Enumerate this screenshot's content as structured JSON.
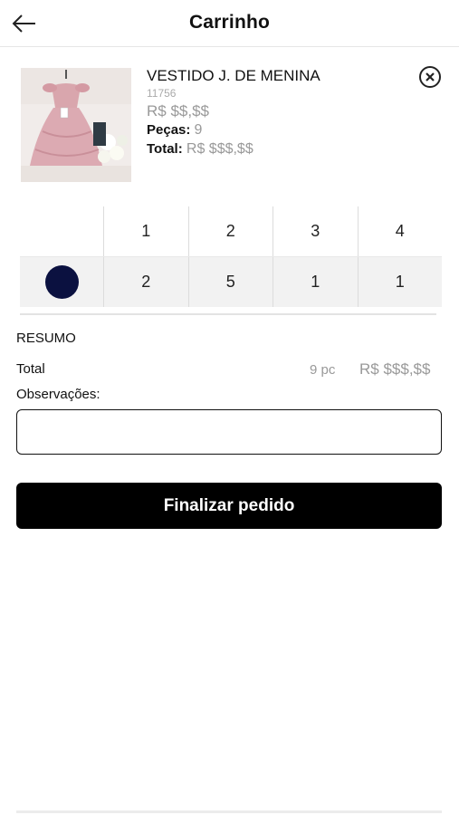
{
  "header": {
    "title": "Carrinho",
    "back_icon": "arrow-left-icon"
  },
  "product": {
    "name": "VESTIDO J. DE MENINA",
    "code": "11756",
    "price": "R$ $$,$$",
    "pieces_label": "Peças:",
    "pieces_value": "9",
    "total_label": "Total:",
    "total_value": "R$ $$$,$$",
    "remove_icon": "close-circle-icon",
    "image_description_icon": "dress-photo"
  },
  "size_grid": {
    "sizes": [
      "1",
      "2",
      "3",
      "4"
    ],
    "rows": [
      {
        "color": "#0b1140",
        "quantities": [
          "2",
          "5",
          "1",
          "1"
        ]
      }
    ]
  },
  "summary": {
    "title": "RESUMO",
    "total_label": "Total",
    "total_pieces": "9 pc",
    "total_value": "R$ $$$,$$",
    "observations_label": "Observações:",
    "observations_value": ""
  },
  "actions": {
    "finish_label": "Finalizar pedido"
  },
  "colors": {
    "accent": "#000000",
    "muted_text": "#999999",
    "swatch_navy": "#0b1140"
  }
}
